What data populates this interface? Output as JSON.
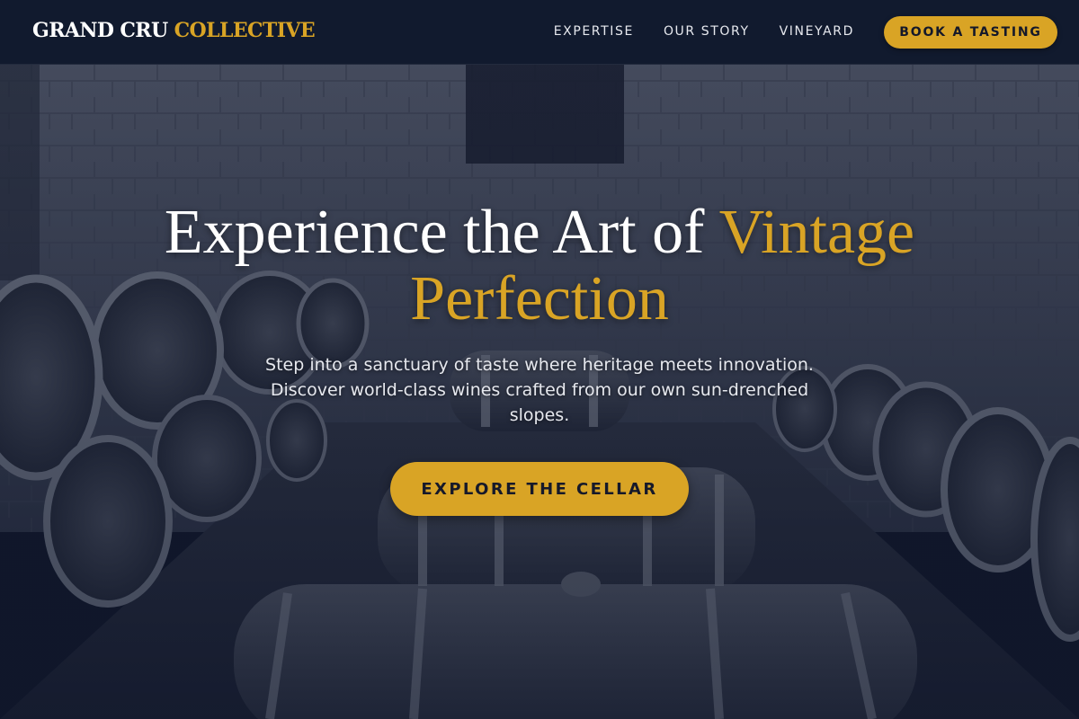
{
  "brand": {
    "name_primary": "GRAND CRU",
    "name_accent": "COLLECTIVE"
  },
  "nav": {
    "links": [
      {
        "label": "EXPERTISE"
      },
      {
        "label": "OUR STORY"
      },
      {
        "label": "VINEYARD"
      }
    ],
    "cta_label": "BOOK A TASTING"
  },
  "hero": {
    "title_main": "Experience the Art of ",
    "title_accent": "Vintage Perfection",
    "subtitle": "Step into a sanctuary of taste where heritage meets innovation. Discover world-class wines crafted from our own sun-drenched slopes.",
    "cta_label": "EXPLORE THE CELLAR",
    "background_icon": "wine-cellar-barrels-image"
  },
  "colors": {
    "accent": "#d9a425",
    "nav_background": "#111a2e",
    "overlay": "#10172c"
  }
}
